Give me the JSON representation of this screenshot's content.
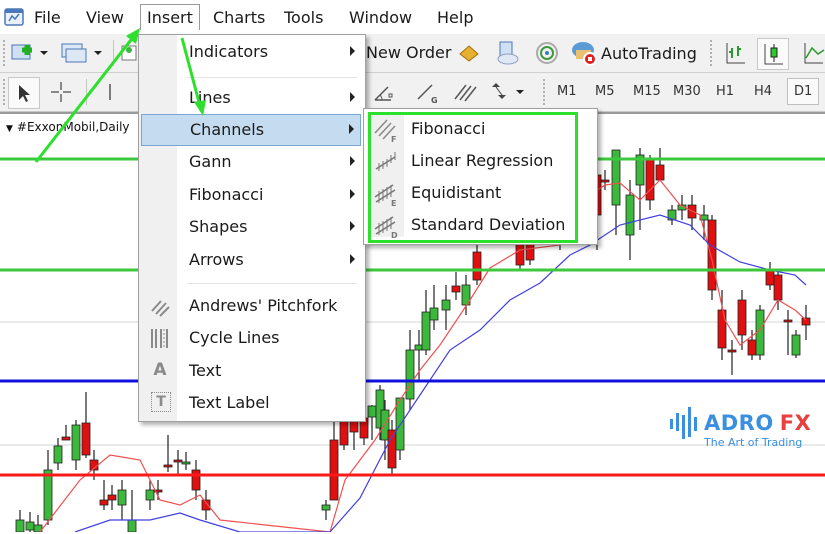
{
  "menubar": {
    "items": [
      {
        "label": "File"
      },
      {
        "label": "View"
      },
      {
        "label": "Insert",
        "open": true
      },
      {
        "label": "Charts"
      },
      {
        "label": "Tools"
      },
      {
        "label": "Window"
      },
      {
        "label": "Help"
      }
    ]
  },
  "toolbar": {
    "new_order_label": "New Order",
    "autotrading_label": "AutoTrading",
    "timeframes": [
      "M1",
      "M5",
      "M15",
      "M30",
      "H1",
      "H4",
      "D1"
    ],
    "active_timeframe": "D1"
  },
  "chart": {
    "title": "#ExxonMobil,Daily",
    "colors": {
      "bull": "#3cb93c",
      "bear": "#e01010",
      "ma_fast": "#f05050",
      "ma_slow": "#4040e0",
      "resistance": "#3cc83c",
      "support_blue": "#1010e0",
      "support_red": "#ff1a1a",
      "highlight": "#2ee02e"
    }
  },
  "insert_menu": {
    "items": [
      {
        "label": "Indicators",
        "submenu": true
      },
      {
        "label": "Lines",
        "submenu": true
      },
      {
        "label": "Channels",
        "submenu": true,
        "highlighted": true
      },
      {
        "label": "Gann",
        "submenu": true
      },
      {
        "label": "Fibonacci",
        "submenu": true
      },
      {
        "label": "Shapes",
        "submenu": true
      },
      {
        "label": "Arrows",
        "submenu": true
      },
      {
        "label": "Andrews' Pitchfork",
        "icon": "pitchfork-icon"
      },
      {
        "label": "Cycle Lines",
        "icon": "cycle-lines-icon"
      },
      {
        "label": "Text",
        "icon": "text-icon",
        "glyph": "A"
      },
      {
        "label": "Text Label",
        "icon": "text-label-icon",
        "glyph": "T"
      }
    ]
  },
  "channels_submenu": {
    "items": [
      {
        "label": "Fibonacci",
        "icon_letter": "F"
      },
      {
        "label": "Linear Regression",
        "icon_letter": ""
      },
      {
        "label": "Equidistant",
        "icon_letter": "E"
      },
      {
        "label": "Standard Deviation",
        "icon_letter": "D"
      }
    ]
  },
  "logo": {
    "brand_a": "ADRO",
    "brand_b": "FX",
    "tagline": "The Art of Trading",
    "color_a": "#3a8fe0",
    "color_b": "#e84040"
  }
}
